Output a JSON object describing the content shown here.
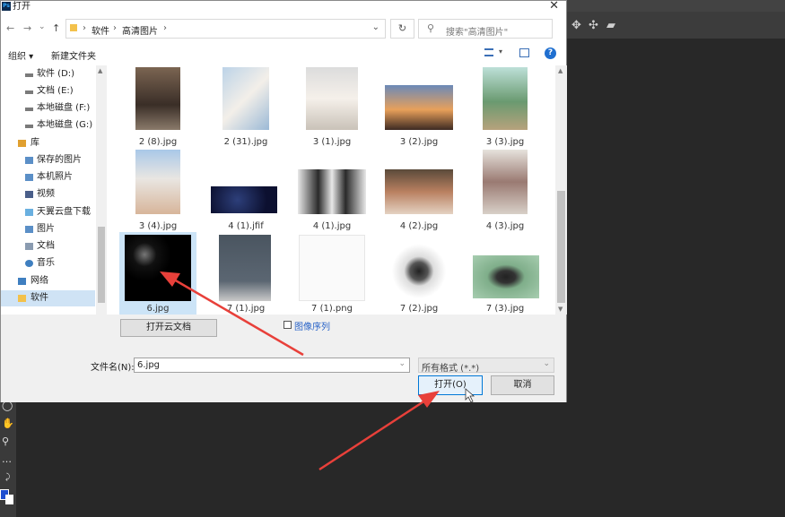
{
  "dialog": {
    "title": "打开",
    "app_icon": "Ps"
  },
  "nav": {
    "back": "←",
    "forward": "→",
    "dropdown": "⌄",
    "up": "↑"
  },
  "address": {
    "crumbs": [
      "软件",
      "高清图片"
    ],
    "refresh": "↻"
  },
  "search": {
    "placeholder": "搜索\"高清图片\""
  },
  "toolbar": {
    "organize": "组织 ▾",
    "new_folder": "新建文件夹",
    "help": "?"
  },
  "sidebar": {
    "items": [
      {
        "label": "软件 (D:)",
        "icon": "drive-icon"
      },
      {
        "label": "文档 (E:)",
        "icon": "drive-icon"
      },
      {
        "label": "本地磁盘 (F:)",
        "icon": "drive-icon"
      },
      {
        "label": "本地磁盘 (G:)",
        "icon": "drive-icon"
      },
      {
        "label": "库",
        "icon": "library-icon"
      },
      {
        "label": "保存的图片",
        "icon": "pictures-icon"
      },
      {
        "label": "本机照片",
        "icon": "pictures-icon"
      },
      {
        "label": "视频",
        "icon": "video-icon"
      },
      {
        "label": "天翼云盘下载",
        "icon": "cloud-folder-icon"
      },
      {
        "label": "图片",
        "icon": "pictures-icon"
      },
      {
        "label": "文档",
        "icon": "documents-icon"
      },
      {
        "label": "音乐",
        "icon": "music-icon"
      },
      {
        "label": "网络",
        "icon": "network-icon"
      },
      {
        "label": "软件",
        "icon": "folder-icon"
      }
    ]
  },
  "files": [
    {
      "name": "2 (8).jpg"
    },
    {
      "name": "2 (31).jpg"
    },
    {
      "name": "3 (1).jpg"
    },
    {
      "name": "3 (2).jpg"
    },
    {
      "name": "3 (3).jpg"
    },
    {
      "name": "3 (4).jpg"
    },
    {
      "name": "4 (1).jfif"
    },
    {
      "name": "4 (1).jpg"
    },
    {
      "name": "4 (2).jpg"
    },
    {
      "name": "4 (3).jpg"
    },
    {
      "name": "6.jpg"
    },
    {
      "name": "7 (1).jpg"
    },
    {
      "name": "7 (1).png"
    },
    {
      "name": "7 (2).jpg"
    },
    {
      "name": "7 (3).jpg"
    }
  ],
  "lower": {
    "cloud_button": "打开云文档",
    "image_sequence": "图像序列",
    "filename_label": "文件名(N):",
    "filename_value": "6.jpg",
    "filter_value": "所有格式 (*.*)",
    "open_button": "打开(O)",
    "cancel_button": "取消"
  },
  "colors": {
    "accent": "#0078d7",
    "selection": "#cce4f7",
    "annotation_arrow": "#e8403a"
  }
}
